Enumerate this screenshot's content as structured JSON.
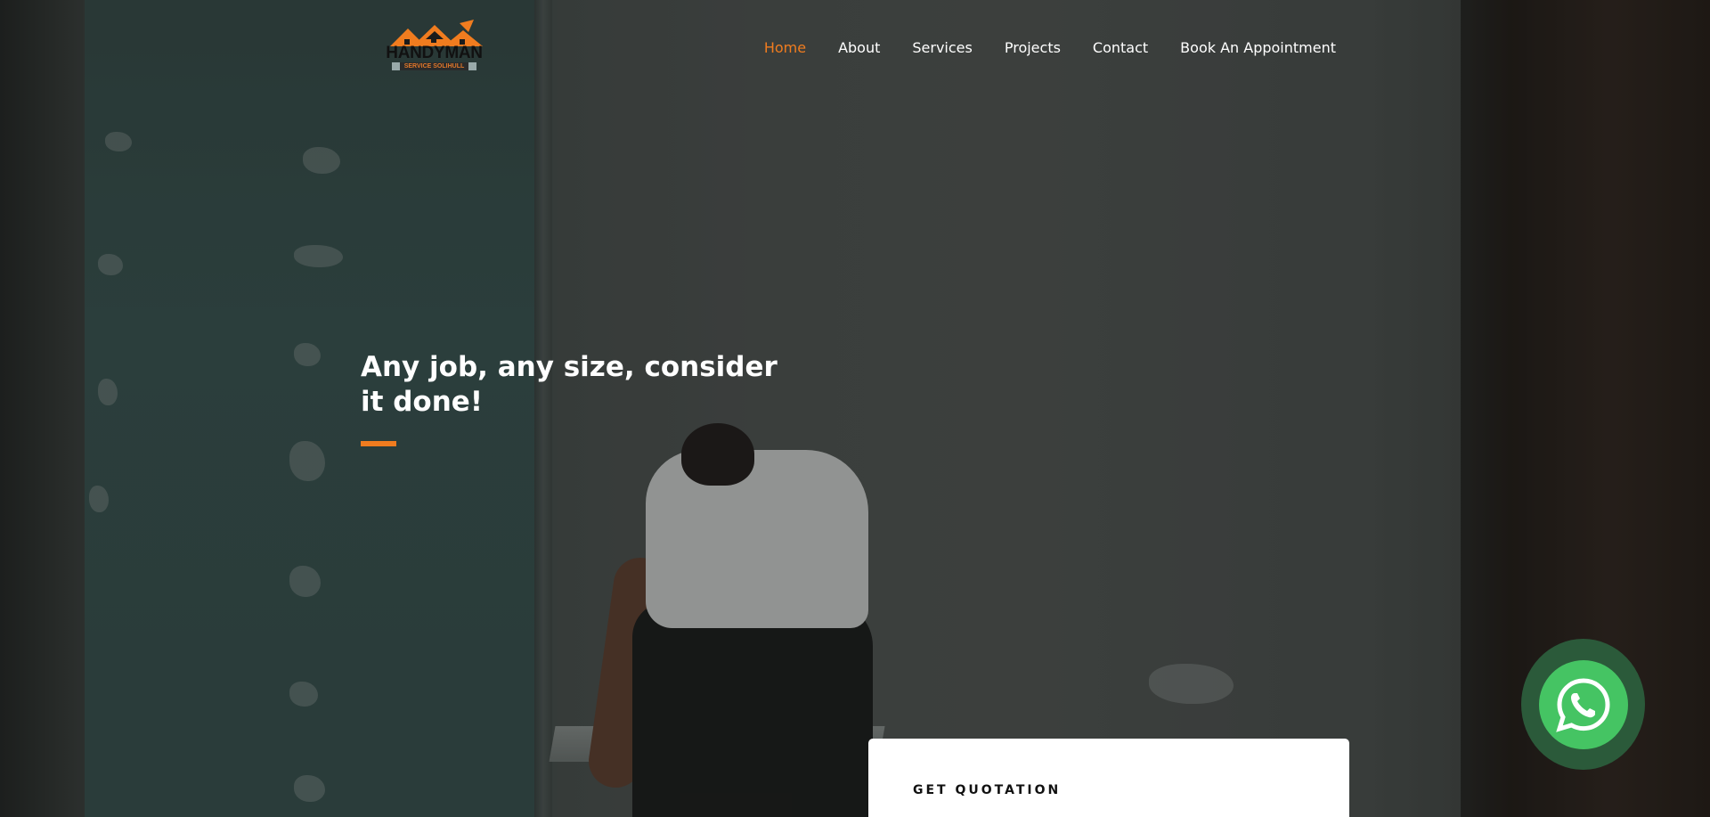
{
  "brand": {
    "name": "HANDYMAN",
    "tagline": "SERVICE SOLIHULL"
  },
  "nav": {
    "items": [
      {
        "label": "Home",
        "active": true
      },
      {
        "label": "About"
      },
      {
        "label": "Services"
      },
      {
        "label": "Projects"
      },
      {
        "label": "Contact"
      },
      {
        "label": "Book An Appointment"
      }
    ]
  },
  "hero": {
    "headline": "Any job, any size, consider it done!"
  },
  "quote_card": {
    "title": "GET QUOTATION"
  },
  "colors": {
    "accent": "#f07c1f",
    "whatsapp_green": "#45c463",
    "nav_text": "#ffffff"
  },
  "icons": {
    "whatsapp": "whatsapp-icon",
    "logo": "house-roof-logo"
  }
}
